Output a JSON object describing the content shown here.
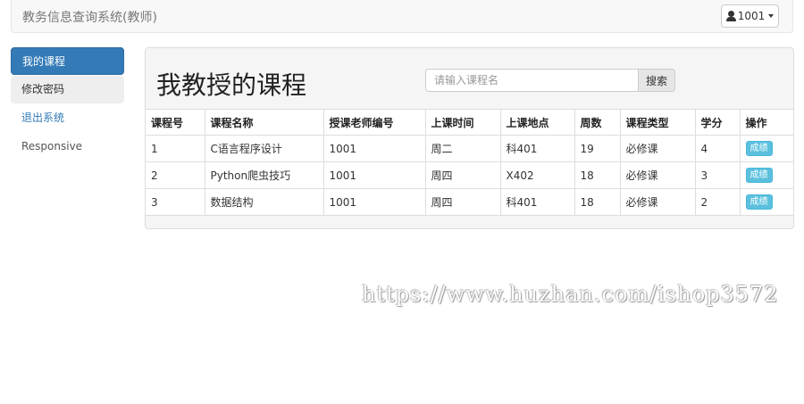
{
  "navbar": {
    "brand": "教务信息查询系统(教师)",
    "user_label": "1001"
  },
  "sidebar": {
    "items": [
      {
        "label": "我的课程"
      },
      {
        "label": "修改密码"
      },
      {
        "label": "退出系统"
      },
      {
        "label": "Responsive"
      }
    ]
  },
  "main": {
    "title": "我教授的课程",
    "search_placeholder": "请输入课程名",
    "search_button": "搜索"
  },
  "table": {
    "headers": [
      "课程号",
      "课程名称",
      "授课老师编号",
      "上课时间",
      "上课地点",
      "周数",
      "课程类型",
      "学分",
      "操作"
    ],
    "rows": [
      {
        "id": "1",
        "name": "C语言程序设计",
        "teacher": "1001",
        "time": "周二",
        "place": "科401",
        "weeks": "19",
        "type": "必修课",
        "credit": "4",
        "action": "成绩"
      },
      {
        "id": "2",
        "name": "Python爬虫技巧",
        "teacher": "1001",
        "time": "周四",
        "place": "X402",
        "weeks": "18",
        "type": "必修课",
        "credit": "3",
        "action": "成绩"
      },
      {
        "id": "3",
        "name": "数据结构",
        "teacher": "1001",
        "time": "周四",
        "place": "科401",
        "weeks": "18",
        "type": "必修课",
        "credit": "2",
        "action": "成绩"
      }
    ]
  },
  "watermark": "https://www.huzhan.com/ishop3572",
  "colors": {
    "primary": "#337ab7",
    "info": "#5bc0de"
  }
}
